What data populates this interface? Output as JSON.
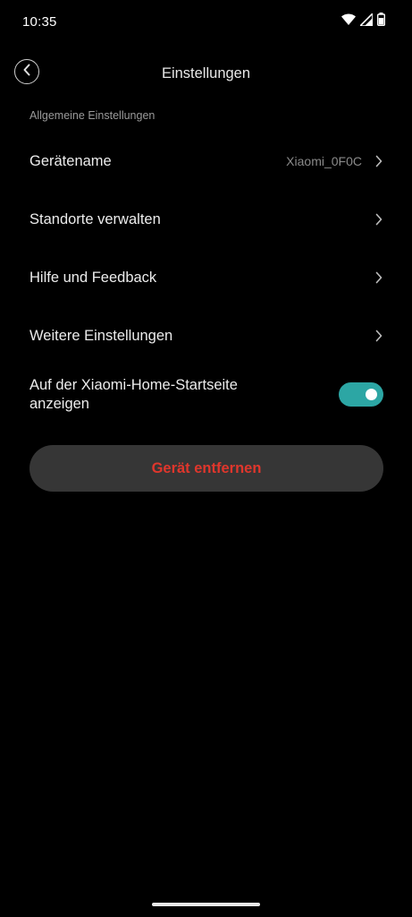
{
  "status_bar": {
    "time": "10:35"
  },
  "header": {
    "title": "Einstellungen"
  },
  "section": {
    "label": "Allgemeine Einstellungen"
  },
  "settings": {
    "device_name_label": "Gerätename",
    "device_name_value": "Xiaomi_0F0C",
    "manage_locations_label": "Standorte verwalten",
    "help_feedback_label": "Hilfe und Feedback",
    "more_settings_label": "Weitere Einstellungen",
    "show_on_home_label": "Auf der Xiaomi-Home-Startseite anzeigen",
    "show_on_home_enabled": true
  },
  "actions": {
    "remove_device_label": "Gerät entfernen"
  },
  "colors": {
    "background": "#000000",
    "toggle_on": "#2ca6a4",
    "danger": "#e0362c",
    "button_bg": "#363636"
  },
  "icons": {
    "back": "chevron-left-icon",
    "row_arrow": "chevron-right-icon",
    "wifi": "wifi-icon",
    "signal": "cell-signal-icon",
    "battery": "battery-icon"
  }
}
